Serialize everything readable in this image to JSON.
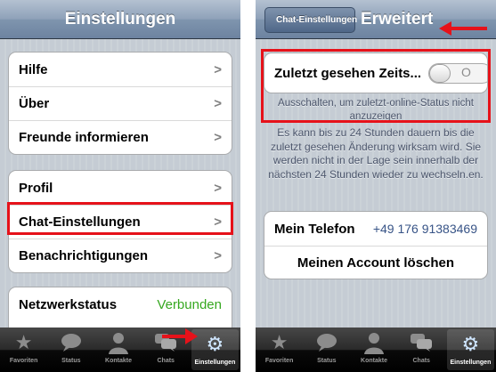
{
  "left_screen": {
    "title": "Einstellungen",
    "groups": [
      [
        {
          "label": "Hilfe"
        },
        {
          "label": "Über"
        },
        {
          "label": "Freunde informieren"
        }
      ],
      [
        {
          "label": "Profil"
        },
        {
          "label": "Chat-Einstellungen"
        },
        {
          "label": "Benachrichtigungen"
        }
      ]
    ],
    "network": {
      "label": "Netzwerkstatus",
      "value": "Verbunden"
    },
    "chevron": ">"
  },
  "right_screen": {
    "back_label": "Chat-Einstellungen",
    "title": "Erweitert",
    "last_seen": {
      "label": "Zuletzt gesehen Zeits...",
      "toggle_text": "O",
      "toggle_state": "off"
    },
    "last_seen_hint": "Ausschalten, um zuletzt-online-Status nicht anzuzeigen",
    "info_text": "Es kann bis zu 24 Stunden dauern bis die zuletzt gesehen Änderung wirksam wird. Sie werden nicht in der Lage sein innerhalb der nächsten 24 Stunden wieder zu wechseln.en.",
    "phone_label": "Mein Telefon",
    "phone_number": "+49 176 91383469",
    "delete_account": "Meinen Account löschen"
  },
  "tabs": [
    {
      "label": "Favoriten",
      "icon": "star-icon"
    },
    {
      "label": "Status",
      "icon": "speech-bubble-icon"
    },
    {
      "label": "Kontakte",
      "icon": "person-icon"
    },
    {
      "label": "Chats",
      "icon": "chats-icon"
    },
    {
      "label": "Einstellungen",
      "icon": "gear-icon",
      "active": true
    }
  ],
  "colors": {
    "annotation_red": "#e6121a",
    "connected_green": "#36a820",
    "phone_blue": "#385487"
  }
}
